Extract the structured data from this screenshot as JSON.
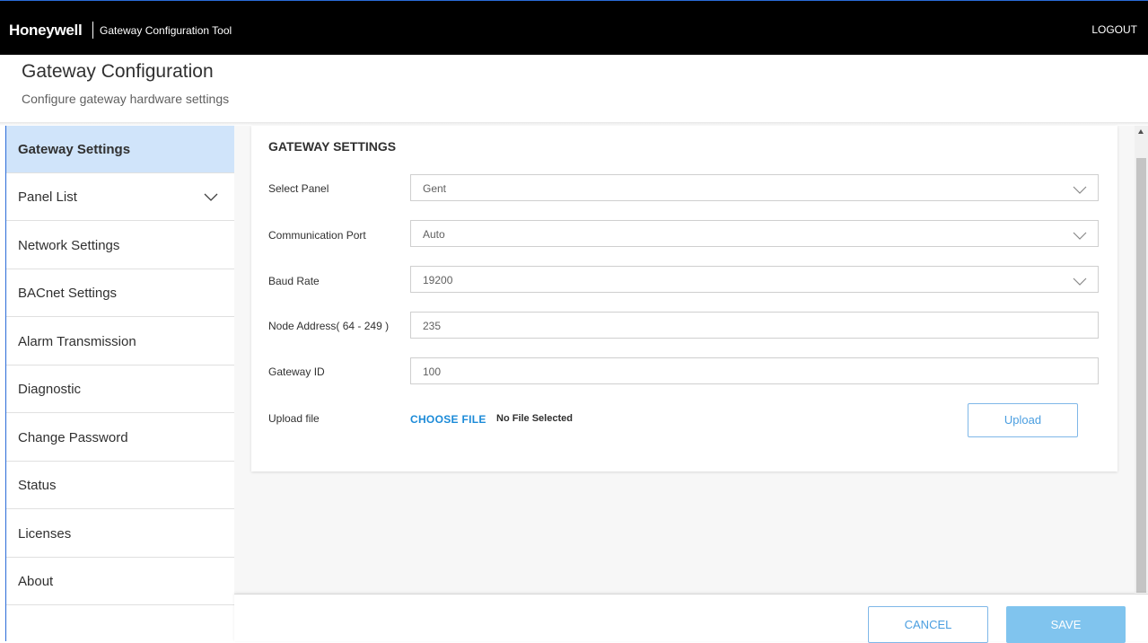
{
  "header": {
    "brand": "Honeywell",
    "app_title": "Gateway Configuration Tool",
    "logout_label": "LOGOUT"
  },
  "page": {
    "title": "Gateway Configuration",
    "subtitle": "Configure gateway hardware settings"
  },
  "sidebar": {
    "items": [
      {
        "label": "Gateway Settings",
        "active": true
      },
      {
        "label": "Panel List",
        "has_chevron": true
      },
      {
        "label": "Network Settings"
      },
      {
        "label": "BACnet Settings"
      },
      {
        "label": "Alarm Transmission"
      },
      {
        "label": "Diagnostic"
      },
      {
        "label": "Change Password"
      },
      {
        "label": "Status"
      },
      {
        "label": "Licenses"
      },
      {
        "label": "About"
      }
    ]
  },
  "form": {
    "section_title": "GATEWAY SETTINGS",
    "select_panel": {
      "label": "Select Panel",
      "value": "Gent"
    },
    "communication_port": {
      "label": "Communication Port",
      "value": "Auto"
    },
    "baud_rate": {
      "label": "Baud Rate",
      "value": "19200"
    },
    "node_address": {
      "label": "Node Address( 64 - 249 )",
      "value": "235"
    },
    "gateway_id": {
      "label": "Gateway ID",
      "value": "100"
    },
    "upload": {
      "label": "Upload file",
      "choose_label": "CHOOSE FILE",
      "file_status": "No File Selected",
      "button_label": "Upload"
    }
  },
  "footer": {
    "cancel_label": "CANCEL",
    "save_label": "SAVE"
  },
  "colors": {
    "header_bg": "#000000",
    "accent": "#1c8bd8",
    "active_nav_bg": "#d0e4fa",
    "save_bg": "#80c4ee"
  }
}
